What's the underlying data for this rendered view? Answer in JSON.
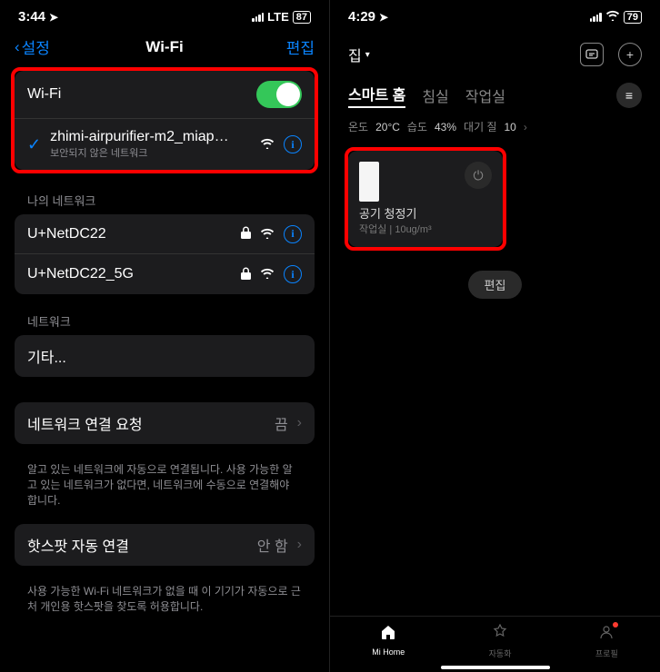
{
  "left": {
    "status": {
      "time": "3:44",
      "net_label": "LTE",
      "battery": "87"
    },
    "nav": {
      "back": "설정",
      "title": "Wi-Fi",
      "edit": "편집"
    },
    "wifi_row_label": "Wi-Fi",
    "connected": {
      "ssid": "zhimi-airpurifier-m2_miapd9...",
      "sub": "보안되지 않은 네트워크"
    },
    "my_networks_header": "나의 네트워크",
    "networks": [
      {
        "ssid": "U+NetDC22"
      },
      {
        "ssid": "U+NetDC22_5G"
      }
    ],
    "networks_header": "네트워크",
    "other": "기타...",
    "ask_join": {
      "label": "네트워크 연결 요청",
      "value": "끔",
      "footer": "알고 있는 네트워크에 자동으로 연결됩니다. 사용 가능한 알고 있는 네트워크가 없다면, 네트워크에 수동으로 연결해야 합니다."
    },
    "hotspot": {
      "label": "핫스팟 자동 연결",
      "value": "안 함",
      "footer": "사용 가능한 Wi-Fi 네트워크가 없을 때 이 기기가 자동으로 근처 개인용 핫스팟을 찾도록 허용합니다."
    }
  },
  "right": {
    "status": {
      "time": "4:29",
      "battery": "79"
    },
    "home_label": "집",
    "tabs": {
      "t1": "스마트 홈",
      "t2": "침실",
      "t3": "작업실"
    },
    "env": {
      "temp_label": "온도",
      "temp": "20°C",
      "hum_label": "습도",
      "hum": "43%",
      "air_label": "대기 질",
      "air": "10"
    },
    "card": {
      "name": "공기 청정기",
      "detail": "작업실 | 10ug/m³"
    },
    "edit": "편집",
    "tabbar": {
      "home": "Mi Home",
      "auto": "자동화",
      "profile": "프로필"
    }
  }
}
